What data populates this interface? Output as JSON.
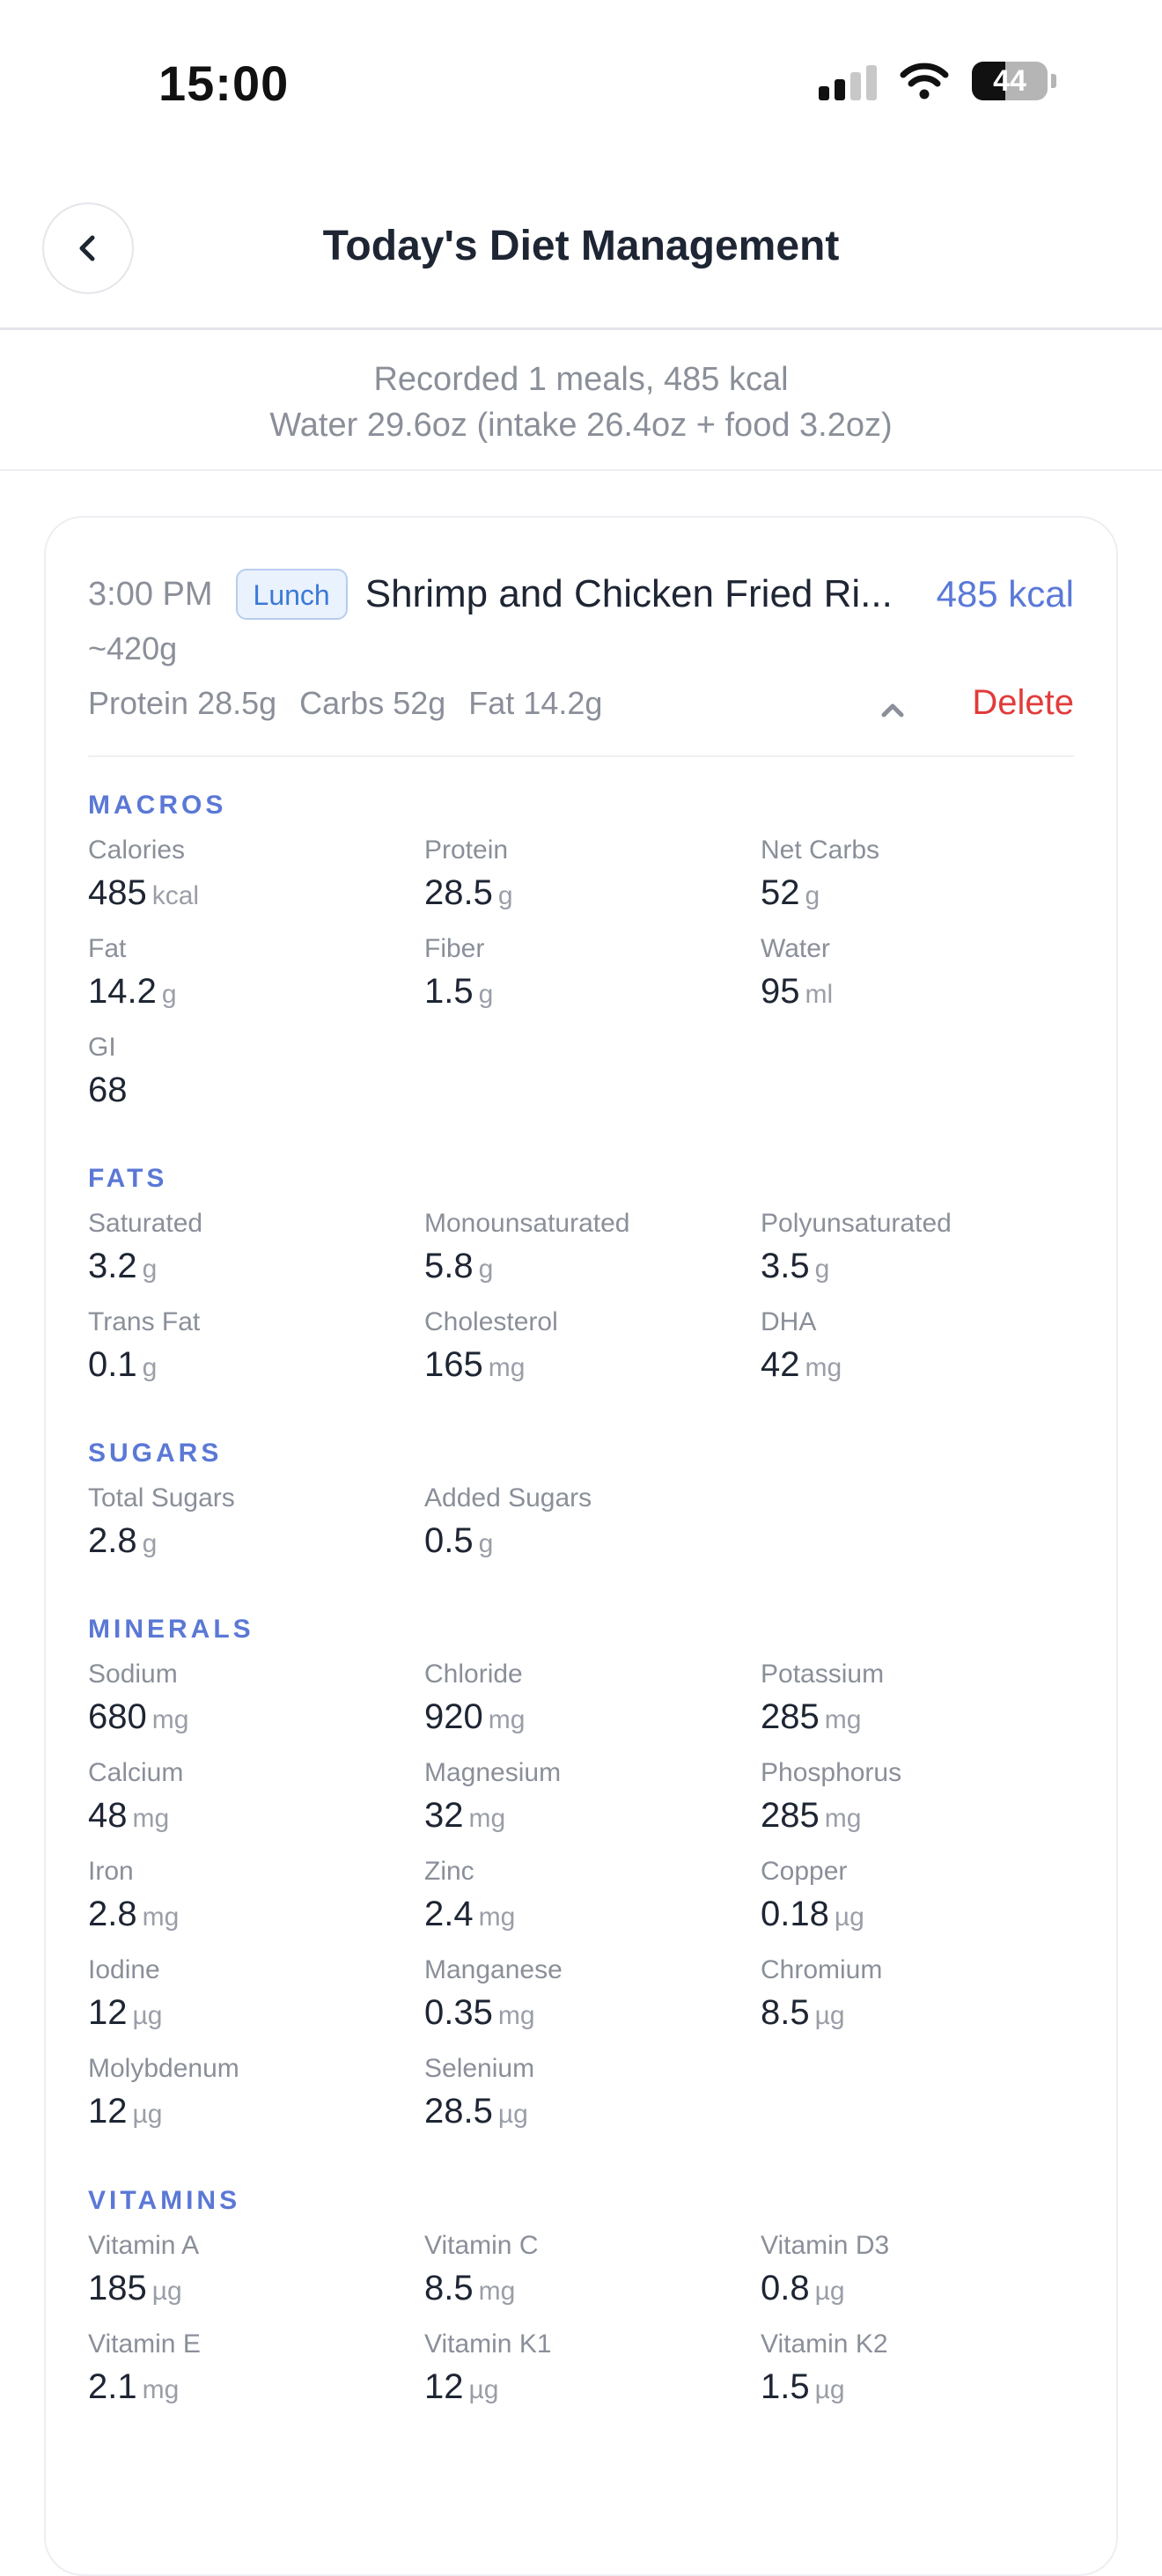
{
  "status_bar": {
    "time": "15:00",
    "battery": "44",
    "battery_level": 0.44
  },
  "header": {
    "title": "Today's Diet Management",
    "back_icon": "chevron-left-icon"
  },
  "summary": {
    "line1": "Recorded 1 meals, 485 kcal",
    "line2": "Water 29.6oz (intake 26.4oz + food 3.2oz)"
  },
  "meal": {
    "time": "3:00 PM",
    "type": "Lunch",
    "name": "Shrimp and Chicken Fried Ri...",
    "kcal": "485 kcal",
    "weight": "~420g",
    "protein": "Protein 28.5g",
    "carbs": "Carbs 52g",
    "fat": "Fat 14.2g",
    "delete_label": "Delete",
    "collapse_icon": "chevron-up-icon"
  },
  "sections": {
    "macros": {
      "title": "MACROS",
      "items": [
        {
          "label": "Calories",
          "value": "485",
          "unit": "kcal"
        },
        {
          "label": "Protein",
          "value": "28.5",
          "unit": "g"
        },
        {
          "label": "Net Carbs",
          "value": "52",
          "unit": "g"
        },
        {
          "label": "Fat",
          "value": "14.2",
          "unit": "g"
        },
        {
          "label": "Fiber",
          "value": "1.5",
          "unit": "g"
        },
        {
          "label": "Water",
          "value": "95",
          "unit": "ml"
        },
        {
          "label": "GI",
          "value": "68",
          "unit": ""
        }
      ]
    },
    "fats": {
      "title": "FATS",
      "items": [
        {
          "label": "Saturated",
          "value": "3.2",
          "unit": "g"
        },
        {
          "label": "Monounsaturated",
          "value": "5.8",
          "unit": "g"
        },
        {
          "label": "Polyunsaturated",
          "value": "3.5",
          "unit": "g"
        },
        {
          "label": "Trans Fat",
          "value": "0.1",
          "unit": "g"
        },
        {
          "label": "Cholesterol",
          "value": "165",
          "unit": "mg"
        },
        {
          "label": "DHA",
          "value": "42",
          "unit": "mg"
        }
      ]
    },
    "sugars": {
      "title": "SUGARS",
      "items": [
        {
          "label": "Total Sugars",
          "value": "2.8",
          "unit": "g"
        },
        {
          "label": "Added Sugars",
          "value": "0.5",
          "unit": "g"
        }
      ]
    },
    "minerals": {
      "title": "MINERALS",
      "items": [
        {
          "label": "Sodium",
          "value": "680",
          "unit": "mg"
        },
        {
          "label": "Chloride",
          "value": "920",
          "unit": "mg"
        },
        {
          "label": "Potassium",
          "value": "285",
          "unit": "mg"
        },
        {
          "label": "Calcium",
          "value": "48",
          "unit": "mg"
        },
        {
          "label": "Magnesium",
          "value": "32",
          "unit": "mg"
        },
        {
          "label": "Phosphorus",
          "value": "285",
          "unit": "mg"
        },
        {
          "label": "Iron",
          "value": "2.8",
          "unit": "mg"
        },
        {
          "label": "Zinc",
          "value": "2.4",
          "unit": "mg"
        },
        {
          "label": "Copper",
          "value": "0.18",
          "unit": "µg"
        },
        {
          "label": "Iodine",
          "value": "12",
          "unit": "µg"
        },
        {
          "label": "Manganese",
          "value": "0.35",
          "unit": "mg"
        },
        {
          "label": "Chromium",
          "value": "8.5",
          "unit": "µg"
        },
        {
          "label": "Molybdenum",
          "value": "12",
          "unit": "µg"
        },
        {
          "label": "Selenium",
          "value": "28.5",
          "unit": "µg"
        }
      ]
    },
    "vitamins": {
      "title": "VITAMINS",
      "items": [
        {
          "label": "Vitamin A",
          "value": "185",
          "unit": "µg"
        },
        {
          "label": "Vitamin C",
          "value": "8.5",
          "unit": "mg"
        },
        {
          "label": "Vitamin D3",
          "value": "0.8",
          "unit": "µg"
        },
        {
          "label": "Vitamin E",
          "value": "2.1",
          "unit": "mg"
        },
        {
          "label": "Vitamin K1",
          "value": "12",
          "unit": "µg"
        },
        {
          "label": "Vitamin K2",
          "value": "1.5",
          "unit": "µg"
        }
      ]
    }
  }
}
